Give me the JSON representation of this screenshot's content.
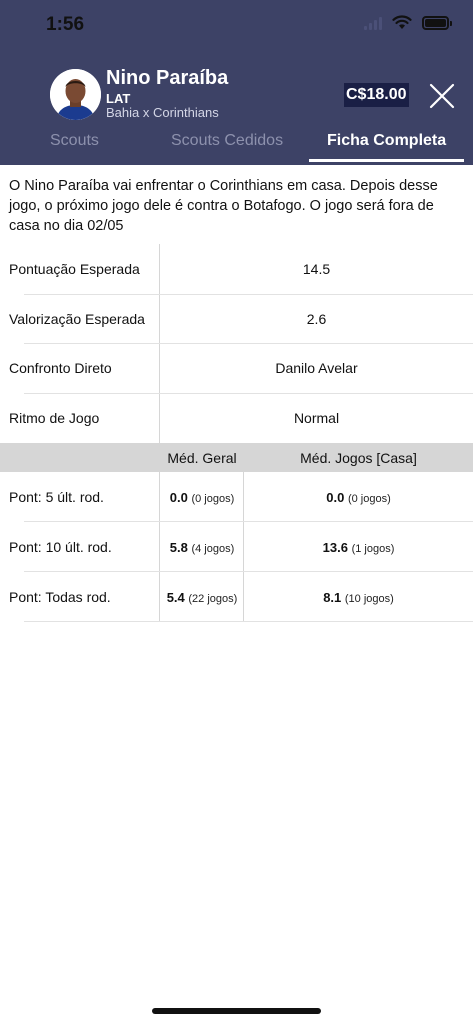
{
  "status_bar": {
    "time": "1:56"
  },
  "player": {
    "name": "Nino Paraíba",
    "position": "LAT",
    "match": "Bahia x Corinthians",
    "price": "C$18.00"
  },
  "tabs": [
    {
      "label": "Scouts",
      "active": false
    },
    {
      "label": "Scouts Cedidos",
      "active": false
    },
    {
      "label": "Ficha Completa",
      "active": true
    }
  ],
  "description": "O Nino Paraíba vai enfrentar o Corinthians em casa. Depois desse jogo, o próximo jogo dele é contra o Botafogo. O jogo será fora de casa no dia 02/05",
  "info_rows": [
    {
      "label": "Pontuação Esperada",
      "value": "14.5"
    },
    {
      "label": "Valorização Esperada",
      "value": "2.6"
    },
    {
      "label": "Confronto Direto",
      "value": "Danilo Avelar"
    },
    {
      "label": "Ritmo de Jogo",
      "value": "Normal"
    }
  ],
  "averages": {
    "headers": [
      "Méd. Geral",
      "Méd. Jogos [Casa]"
    ],
    "rows": [
      {
        "label": "Pont: 5 últ. rod.",
        "geral": "0.0",
        "geral_games": "(0 jogos)",
        "casa": "0.0",
        "casa_games": "(0 jogos)"
      },
      {
        "label": "Pont: 10 últ. rod.",
        "geral": "5.8",
        "geral_games": "(4 jogos)",
        "casa": "13.6",
        "casa_games": "(1 jogos)"
      },
      {
        "label": "Pont: Todas rod.",
        "geral": "5.4",
        "geral_games": "(22 jogos)",
        "casa": "8.1",
        "casa_games": "(10 jogos)"
      }
    ]
  },
  "icons": {
    "close": "close-icon",
    "wifi": "wifi-icon",
    "battery": "battery-icon",
    "signal": "signal-icon"
  },
  "colors": {
    "header_bg": "#3d4266",
    "price_bg": "#1a1f45",
    "table_header_bg": "#d6d6d6"
  }
}
